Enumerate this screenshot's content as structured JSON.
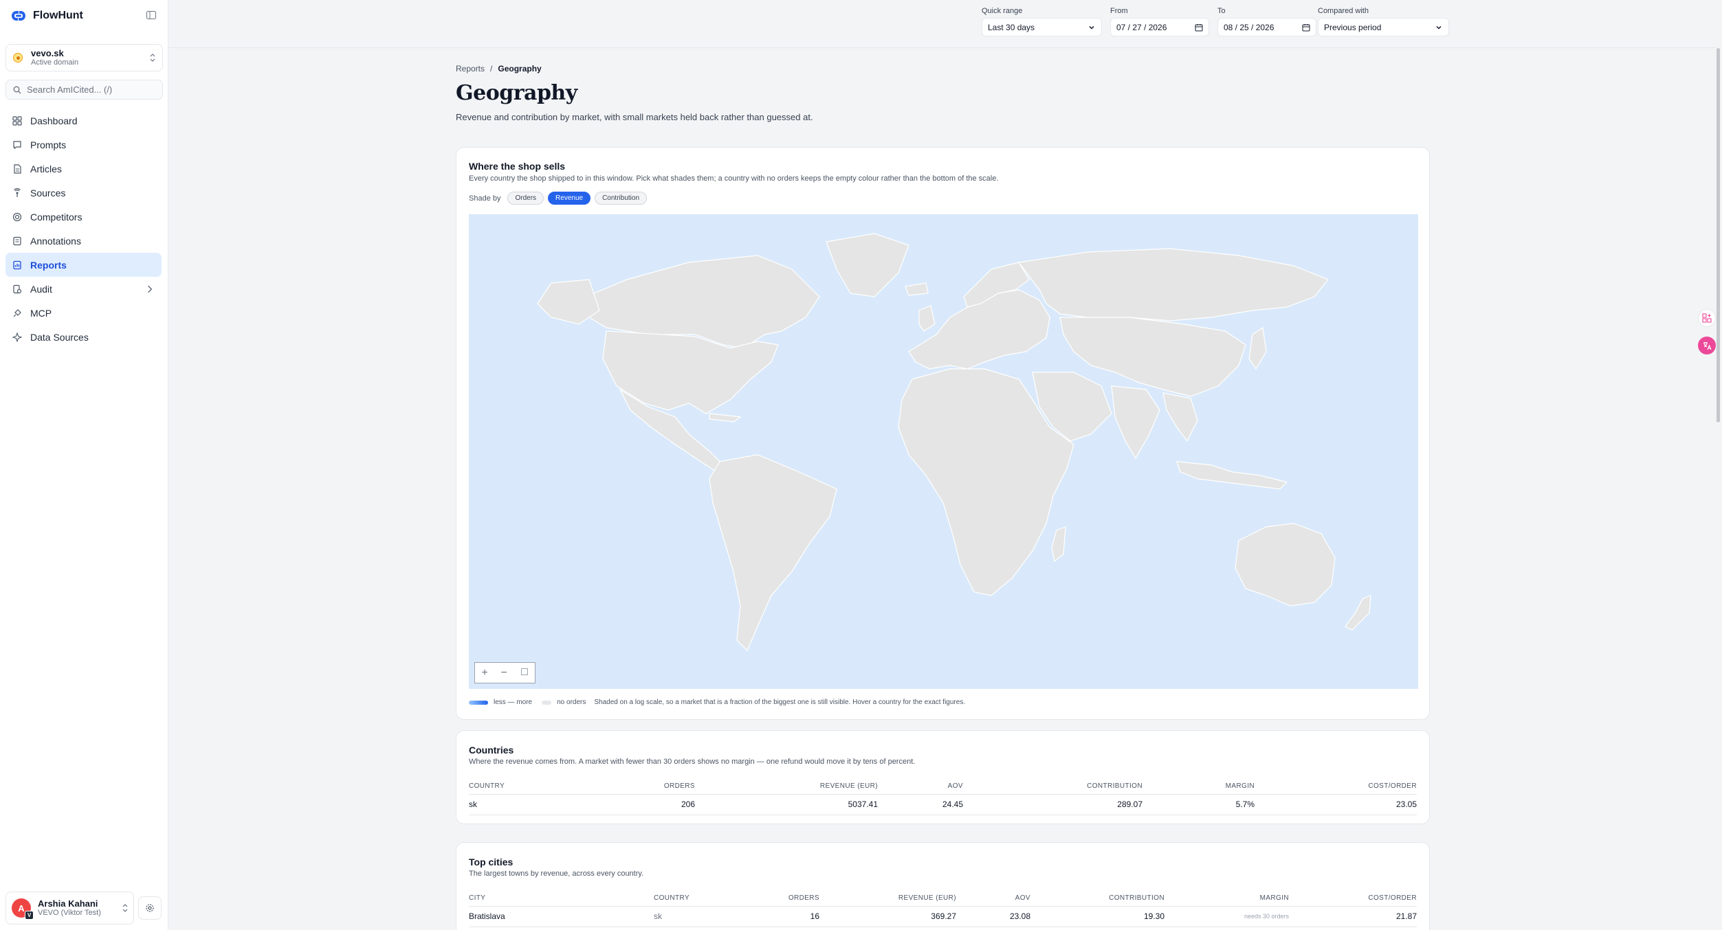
{
  "app": {
    "name": "FlowHunt"
  },
  "domain": {
    "name": "vevo.sk",
    "status": "Active domain"
  },
  "search": {
    "placeholder": "Search AmICited... (/)"
  },
  "nav": [
    {
      "label": "Dashboard",
      "icon": "grid-icon"
    },
    {
      "label": "Prompts",
      "icon": "chat-icon"
    },
    {
      "label": "Articles",
      "icon": "document-icon"
    },
    {
      "label": "Sources",
      "icon": "broadcast-icon"
    },
    {
      "label": "Competitors",
      "icon": "target-icon"
    },
    {
      "label": "Annotations",
      "icon": "note-icon"
    },
    {
      "label": "Reports",
      "icon": "report-icon",
      "active": true
    },
    {
      "label": "Audit",
      "icon": "audit-icon",
      "has_children": true
    },
    {
      "label": "MCP",
      "icon": "plug-icon"
    },
    {
      "label": "Data Sources",
      "icon": "sparkle-icon"
    }
  ],
  "user": {
    "initial": "A",
    "badge": "V",
    "name": "Arshia Kahani",
    "org": "VEVO (Viktor Test)"
  },
  "filters": {
    "quick_range": {
      "label": "Quick range",
      "value": "Last 30 days"
    },
    "from": {
      "label": "From",
      "value": "07 / 27 / 2026"
    },
    "to": {
      "label": "To",
      "value": "08 / 25 / 2026"
    },
    "compared": {
      "label": "Compared with",
      "value": "Previous period"
    }
  },
  "breadcrumb": {
    "parent": "Reports",
    "separator": "/",
    "current": "Geography"
  },
  "page": {
    "title": "Geography",
    "subtitle": "Revenue and contribution by market, with small markets held back rather than guessed at."
  },
  "map_card": {
    "title": "Where the shop sells",
    "desc": "Every country the shop shipped to in this window. Pick what shades them; a country with no orders keeps the empty colour rather than the bottom of the scale.",
    "shade_label": "Shade by",
    "shade_options": [
      "Orders",
      "Revenue",
      "Contribution"
    ],
    "shade_selected": "Revenue",
    "zoom_in": "+",
    "zoom_out": "−",
    "legend_scale": "less — more",
    "legend_empty": "no orders",
    "legend_note": "Shaded on a log scale, so a market that is a fraction of the biggest one is still visible. Hover a country for the exact figures.",
    "colors": {
      "ocean": "#d9e9fb",
      "land": "#e5e5e5",
      "border": "#ffffff",
      "accent": "#2563eb"
    }
  },
  "countries_card": {
    "title": "Countries",
    "desc": "Where the revenue comes from. A market with fewer than 30 orders shows no margin — one refund would move it by tens of percent.",
    "columns": [
      "Country",
      "Orders",
      "Revenue (EUR)",
      "AOV",
      "Contribution",
      "Margin",
      "Cost/Order"
    ],
    "rows": [
      {
        "country": "sk",
        "orders": "206",
        "revenue": "5037.41",
        "aov": "24.45",
        "contribution": "289.07",
        "margin": "5.7%",
        "cost": "23.05"
      }
    ]
  },
  "cities_card": {
    "title": "Top cities",
    "desc": "The largest towns by revenue, across every country.",
    "columns": [
      "City",
      "Country",
      "Orders",
      "Revenue (EUR)",
      "AOV",
      "Contribution",
      "Margin",
      "Cost/Order"
    ],
    "rows": [
      {
        "city": "Bratislava",
        "country": "sk",
        "orders": "16",
        "revenue": "369.27",
        "aov": "23.08",
        "contribution": "19.30",
        "margin": "needs 30 orders",
        "cost": "21.87"
      }
    ]
  }
}
